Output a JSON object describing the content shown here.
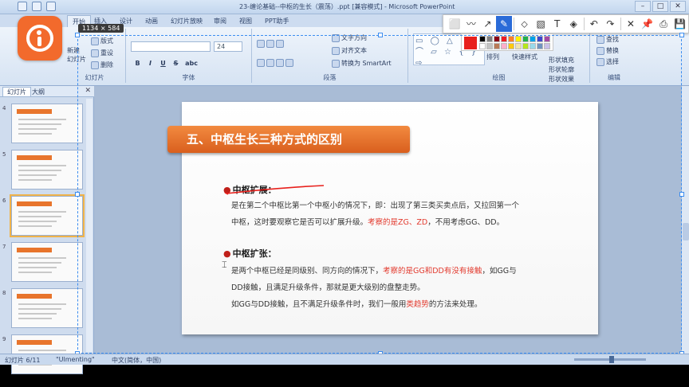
{
  "window": {
    "title": "23-缠论基础--中枢的生长（震荡）.ppt [兼容模式] - Microsoft PowerPoint",
    "minimize": "–",
    "maximize": "□",
    "close": "✕"
  },
  "ribbon_tabs": [
    "开始",
    "插入",
    "设计",
    "动画",
    "幻灯片放映",
    "审阅",
    "视图",
    "PPT助手"
  ],
  "selection_size": "1134 × 584",
  "ribbon": {
    "slides_group": {
      "label": "幻灯片",
      "new_slide": "新建\n幻灯片",
      "layout": "版式",
      "reset": "重设",
      "delete": "删除"
    },
    "font_group": {
      "label": "字体",
      "font_value": "",
      "size_value": "24",
      "bold": "B",
      "italic": "I",
      "underline": "U",
      "strike": "S",
      "shadow": "abc"
    },
    "paragraph_group": {
      "label": "段落",
      "text_direction": "文字方向",
      "align_text": "对齐文本",
      "convert_smartart": "转换为 SmartArt"
    },
    "drawing_group": {
      "label": "绘图",
      "shapes": "▭ ◯ △ ↘ ⌒ ▱ ☆ { } ⇨",
      "arrange": "排列",
      "quick_styles": "快速样式",
      "shape_fill": "形状填充",
      "shape_outline": "形状轮廓",
      "shape_effects": "形状效果"
    },
    "editing_group": {
      "label": "编辑",
      "find": "查找",
      "replace": "替换",
      "select": "选择"
    }
  },
  "annotation_toolbar": {
    "tools": [
      "⬜",
      "〰",
      "↗",
      "✎",
      "⬦",
      "▧",
      "T",
      "◈",
      "↶",
      "↷",
      "✕",
      "📌",
      "⎙",
      "💾"
    ],
    "selected_index": 3,
    "current_color": "#e8201c",
    "palette": [
      "#000000",
      "#7f7f7f",
      "#880015",
      "#ed1c24",
      "#ff7f27",
      "#fff200",
      "#22b14c",
      "#00a2e8",
      "#3f48cc",
      "#a349a4",
      "#ffffff",
      "#c3c3c3",
      "#b97a57",
      "#ffaec9",
      "#ffc90e",
      "#efe4b0",
      "#b5e61d",
      "#99d9ea",
      "#7092be",
      "#c8bfe7"
    ]
  },
  "slides_panel": {
    "tab_slides": "幻灯片",
    "tab_outline": "大纲",
    "close": "✕",
    "thumbnails": [
      "4",
      "5",
      "6",
      "7",
      "8",
      "9"
    ],
    "selected_index": 2
  },
  "slide": {
    "banner": "五、中枢生长三种方式的区别",
    "section1": {
      "heading": "中枢扩展：",
      "line1": "是在第二个中枢比第一个中枢小的情况下，即：出现了第三类买卖点后，又拉回第一个",
      "line2_pre": "中枢，这时要观察它是否可以扩展升级。",
      "line2_red": "考察的是ZG、ZD",
      "line2_post": "，不用考虑GG、DD。"
    },
    "section2": {
      "heading": "中枢扩张：",
      "line1_pre": "是两个中枢已经是同级别、同方向的情况下，",
      "line1_red": "考察的是GG和DD有没有接触",
      "line1_post": "，如GG与",
      "line2": "DD接触，且满足升级条件，那就是更大级别的盘整走势。",
      "line3_pre": "如GG与DD接触，且不满足升级条件时，我们一般用",
      "line3_red": "类趋势",
      "line3_post": "的方法来处理。"
    },
    "bullet_color": "#c0201a",
    "accent_color": "#e8752c"
  },
  "status_bar": {
    "slide_counter": "幻灯片 6/11",
    "theme": "\"Ulmenting\"",
    "language": "中文(简体，中国)"
  }
}
